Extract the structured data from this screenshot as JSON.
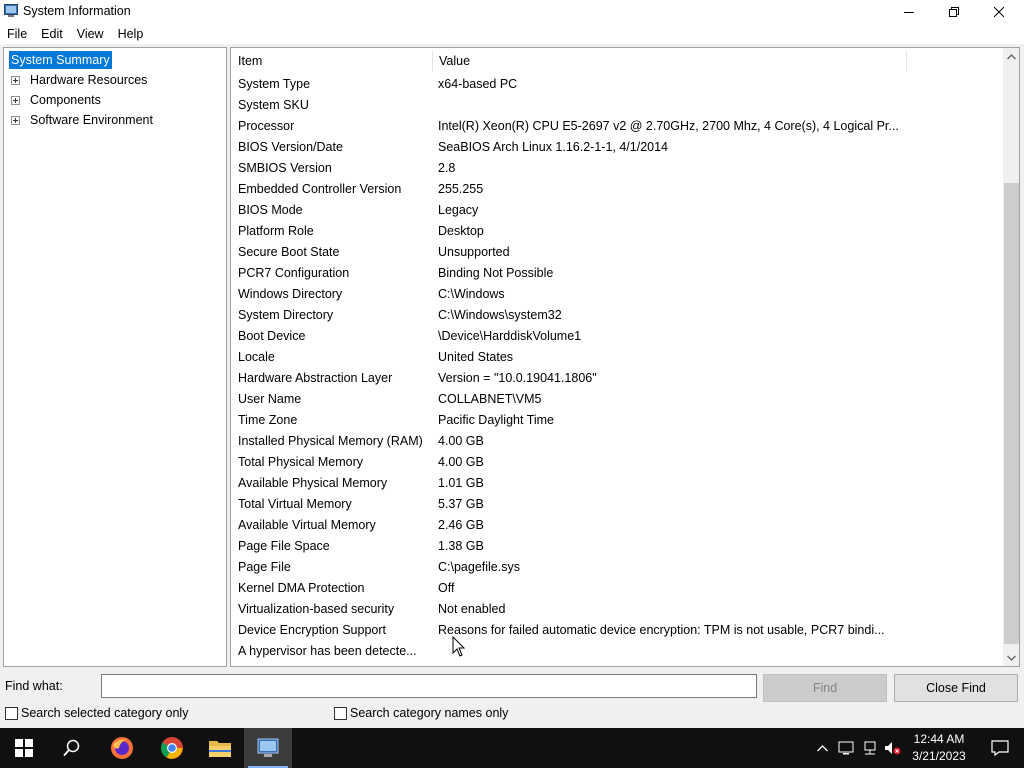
{
  "window": {
    "title": "System Information"
  },
  "menu": [
    "File",
    "Edit",
    "View",
    "Help"
  ],
  "tree": {
    "root": "System Summary",
    "children": [
      "Hardware Resources",
      "Components",
      "Software Environment"
    ]
  },
  "list": {
    "columns": {
      "item": "Item",
      "value": "Value"
    },
    "rows": [
      {
        "item": "System Type",
        "value": "x64-based PC"
      },
      {
        "item": "System SKU",
        "value": ""
      },
      {
        "item": "Processor",
        "value": "Intel(R) Xeon(R) CPU E5-2697 v2 @ 2.70GHz, 2700 Mhz, 4 Core(s), 4 Logical Pr..."
      },
      {
        "item": "BIOS Version/Date",
        "value": "SeaBIOS Arch Linux 1.16.2-1-1, 4/1/2014"
      },
      {
        "item": "SMBIOS Version",
        "value": "2.8"
      },
      {
        "item": "Embedded Controller Version",
        "value": "255.255"
      },
      {
        "item": "BIOS Mode",
        "value": "Legacy"
      },
      {
        "item": "Platform Role",
        "value": "Desktop"
      },
      {
        "item": "Secure Boot State",
        "value": "Unsupported"
      },
      {
        "item": "PCR7 Configuration",
        "value": "Binding Not Possible"
      },
      {
        "item": "Windows Directory",
        "value": "C:\\Windows"
      },
      {
        "item": "System Directory",
        "value": "C:\\Windows\\system32"
      },
      {
        "item": "Boot Device",
        "value": "\\Device\\HarddiskVolume1"
      },
      {
        "item": "Locale",
        "value": "United States"
      },
      {
        "item": "Hardware Abstraction Layer",
        "value": "Version = \"10.0.19041.1806\""
      },
      {
        "item": "User Name",
        "value": "COLLABNET\\VM5"
      },
      {
        "item": "Time Zone",
        "value": "Pacific Daylight Time"
      },
      {
        "item": "Installed Physical Memory (RAM)",
        "value": "4.00 GB"
      },
      {
        "item": "Total Physical Memory",
        "value": "4.00 GB"
      },
      {
        "item": "Available Physical Memory",
        "value": "1.01 GB"
      },
      {
        "item": "Total Virtual Memory",
        "value": "5.37 GB"
      },
      {
        "item": "Available Virtual Memory",
        "value": "2.46 GB"
      },
      {
        "item": "Page File Space",
        "value": "1.38 GB"
      },
      {
        "item": "Page File",
        "value": "C:\\pagefile.sys"
      },
      {
        "item": "Kernel DMA Protection",
        "value": "Off"
      },
      {
        "item": "Virtualization-based security",
        "value": "Not enabled"
      },
      {
        "item": "Device Encryption Support",
        "value": "Reasons for failed automatic device encryption: TPM is not usable, PCR7 bindi..."
      },
      {
        "item": "A hypervisor has been detecte...",
        "value": ""
      }
    ]
  },
  "find": {
    "label": "Find what:",
    "value": "",
    "find_button": "Find",
    "close_button": "Close Find",
    "check_selected": "Search selected category only",
    "check_names": "Search category names only"
  },
  "taskbar": {
    "time": "12:44 AM",
    "date": "3/21/2023"
  },
  "colors": {
    "selection": "#0078d7",
    "taskbar": "#101010"
  }
}
